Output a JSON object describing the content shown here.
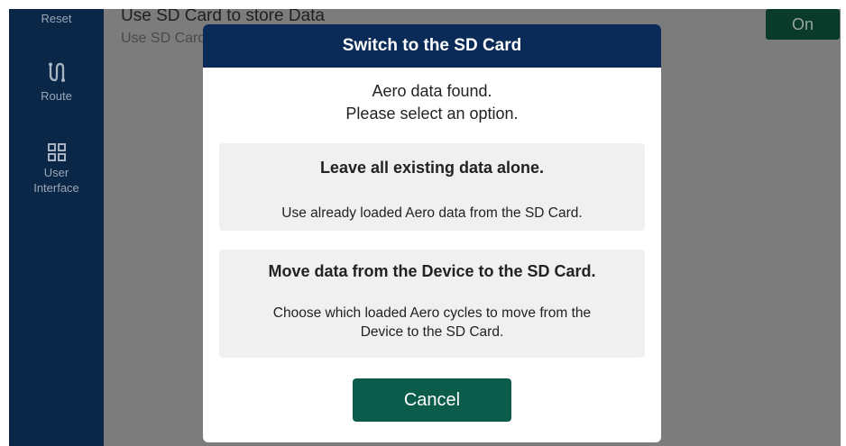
{
  "sidebar": {
    "items": [
      {
        "label": "Reset",
        "icon": "reset-icon"
      },
      {
        "label": "Route",
        "icon": "route-icon"
      },
      {
        "label": "User Interface",
        "icon": "grid-icon"
      }
    ]
  },
  "setting": {
    "title": "Use SD Card to store Data",
    "subtitle": "Use SD Card to store Data",
    "toggle_label": "On"
  },
  "dialog": {
    "title": "Switch to the SD Card",
    "message_line1": "Aero data found.",
    "message_line2": "Please select an option.",
    "options": [
      {
        "title": "Leave all existing data alone.",
        "description": "Use already loaded Aero data from the SD Card."
      },
      {
        "title": "Move data from the Device to the SD Card.",
        "description_line1": "Choose which loaded Aero cycles to move from the",
        "description_line2": "Device to the SD Card."
      }
    ],
    "cancel_label": "Cancel"
  },
  "colors": {
    "sidebar_bg": "#0a2748",
    "dialog_header": "#0a2a58",
    "primary_button": "#0b5c4a",
    "overlay": "#7c7c7c"
  }
}
